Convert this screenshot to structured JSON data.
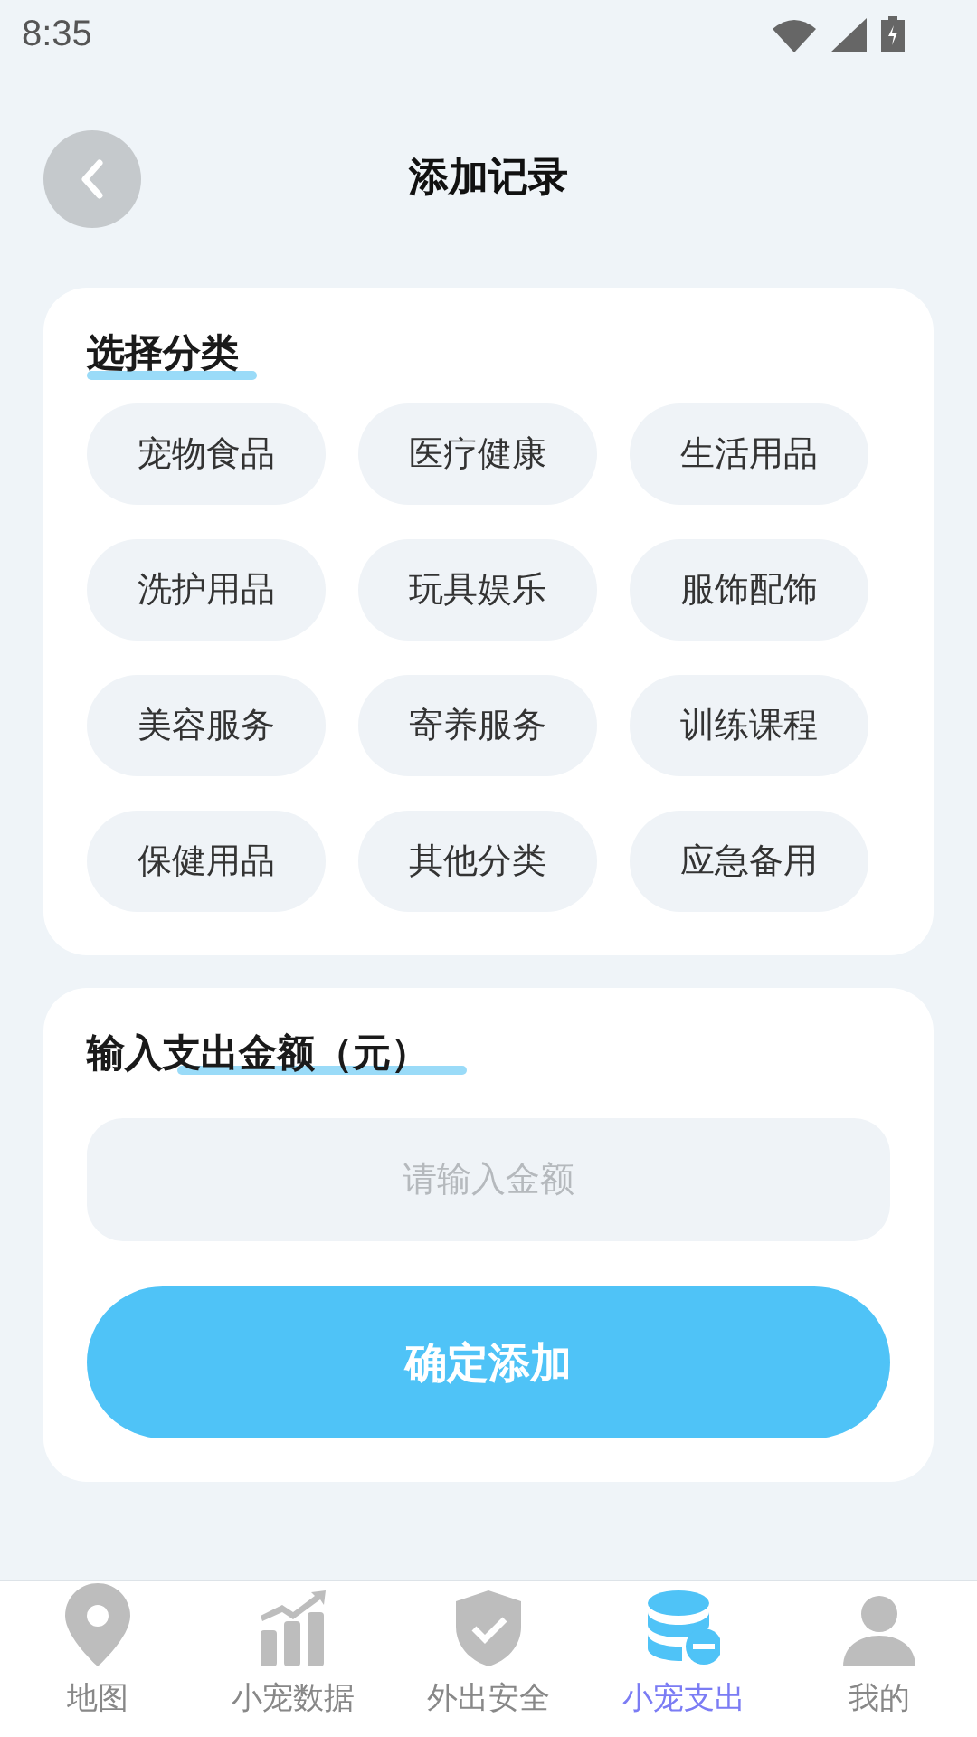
{
  "status_bar": {
    "time": "8:35"
  },
  "header": {
    "title": "添加记录"
  },
  "category_section": {
    "title": "选择分类",
    "categories": [
      {
        "label": "宠物食品",
        "selected": false
      },
      {
        "label": "医疗健康",
        "selected": false
      },
      {
        "label": "生活用品",
        "selected": false
      },
      {
        "label": "洗护用品",
        "selected": false
      },
      {
        "label": "玩具娱乐",
        "selected": false
      },
      {
        "label": "服饰配饰",
        "selected": false
      },
      {
        "label": "美容服务",
        "selected": false
      },
      {
        "label": "寄养服务",
        "selected": false
      },
      {
        "label": "训练课程",
        "selected": false
      },
      {
        "label": "保健用品",
        "selected": false
      },
      {
        "label": "其他分类",
        "selected": false
      },
      {
        "label": "应急备用",
        "selected": false
      }
    ]
  },
  "amount_section": {
    "title": "输入支出金额（元）",
    "placeholder": "请输入金额",
    "submit": "确定添加"
  },
  "bottom_nav": [
    {
      "kind": "map",
      "label": "地图",
      "selected": false
    },
    {
      "kind": "stats",
      "label": "小宠数据",
      "selected": false
    },
    {
      "kind": "safety",
      "label": "外出安全",
      "selected": false
    },
    {
      "kind": "expense",
      "label": "小宠支出",
      "selected": true
    },
    {
      "kind": "profile",
      "label": "我的",
      "selected": false
    }
  ]
}
